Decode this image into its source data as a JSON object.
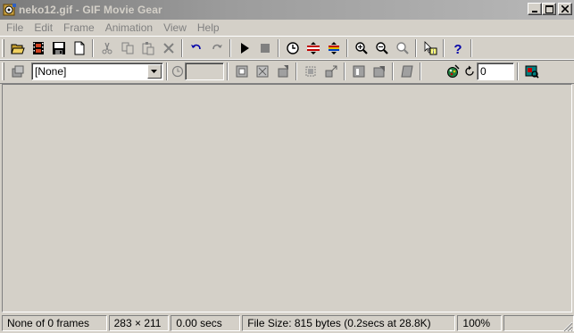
{
  "window": {
    "title": "neko12.gif - GIF Movie Gear",
    "minimize_label": "_",
    "maximize_label": "□",
    "close_label": "✕"
  },
  "menu": {
    "items": [
      "File",
      "Edit",
      "Frame",
      "Animation",
      "View",
      "Help"
    ]
  },
  "toolbar1": {
    "buttons": [
      {
        "icon": "open-folder-icon"
      },
      {
        "icon": "filmstrip-icon"
      },
      {
        "icon": "save-icon"
      },
      {
        "icon": "new-document-icon"
      },
      {
        "icon": "cut-icon"
      },
      {
        "icon": "copy-icon"
      },
      {
        "icon": "paste-icon"
      },
      {
        "icon": "delete-icon"
      },
      {
        "icon": "undo-icon"
      },
      {
        "icon": "redo-icon"
      },
      {
        "icon": "play-icon"
      },
      {
        "icon": "stop-icon"
      },
      {
        "icon": "timing-icon"
      },
      {
        "icon": "optimize-icon"
      },
      {
        "icon": "reduce-colors-icon"
      },
      {
        "icon": "zoom-in-icon"
      },
      {
        "icon": "zoom-out-icon"
      },
      {
        "icon": "zoom-reset-icon"
      },
      {
        "icon": "context-help-icon"
      },
      {
        "icon": "help-icon"
      }
    ]
  },
  "toolbar2": {
    "frame_select_value": "[None]",
    "delay_value": "",
    "loop_count_value": "0"
  },
  "status": {
    "frames": "None of 0 frames",
    "dimensions": "283 × 211",
    "duration": "0.00 secs",
    "file_size": "File Size: 815 bytes  (0.2secs at 28.8K)",
    "zoom": "100%"
  },
  "colors": {
    "face": "#d4d0c8",
    "title_gradient_start": "#7b7b7b",
    "title_text": "#d4d0c8",
    "help_blue": "#0000a8",
    "disabled_gray": "#808080"
  }
}
